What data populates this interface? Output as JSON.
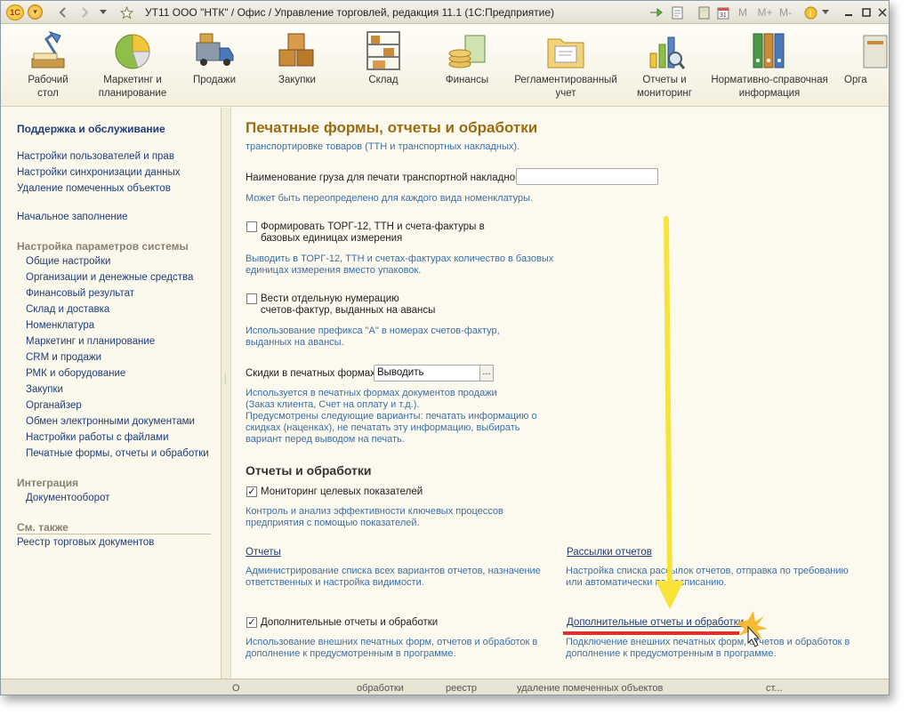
{
  "window": {
    "title": "УТ11 ООО \"НТК\" / Офис / Управление торговлей, редакция 11.1  (1С:Предприятие)",
    "logo": "1С",
    "controls": [
      "minimize",
      "maximize",
      "close"
    ]
  },
  "toolbar_icons": [
    "back-arrow-icon",
    "forward-arrow-icon",
    "dropdown-icon",
    "star-icon"
  ],
  "title_tools": [
    "link-arrow-icon",
    "document-icon",
    "calculator-icon",
    "calendar-icon",
    "M",
    "M+",
    "M-",
    "info-icon"
  ],
  "sections": [
    {
      "label_1": "Рабочий",
      "label_2": "стол",
      "icon": "desk-lamp-icon"
    },
    {
      "label_1": "Маркетинг и",
      "label_2": "планирование",
      "icon": "pie-chart-icon"
    },
    {
      "label_1": "Продажи",
      "label_2": "",
      "icon": "truck-icon"
    },
    {
      "label_1": "Закупки",
      "label_2": "",
      "icon": "boxes-icon"
    },
    {
      "label_1": "Склад",
      "label_2": "",
      "icon": "shelves-icon"
    },
    {
      "label_1": "Финансы",
      "label_2": "",
      "icon": "coins-icon"
    },
    {
      "label_1": "Регламентированный",
      "label_2": "учет",
      "icon": "folder-docs-icon"
    },
    {
      "label_1": "Отчеты и",
      "label_2": "мониторинг",
      "icon": "bar-chart-magnifier-icon"
    },
    {
      "label_1": "Нормативно-справочная",
      "label_2": "информация",
      "icon": "binders-icon"
    },
    {
      "label_1": "Орга",
      "label_2": "",
      "icon": "org-icon"
    }
  ],
  "sidebar": {
    "heading": "Поддержка и обслуживание",
    "items_top": [
      "Настройки пользователей и прав",
      "Настройки синхронизации данных",
      "Удаление помеченных объектов"
    ],
    "initial_fill": "Начальное заполнение",
    "group_system": "Настройка параметров системы",
    "system_items": [
      "Общие настройки",
      "Организации и денежные средства",
      "Финансовый результат",
      "Склад и доставка",
      "Номенклатура",
      "Маркетинг и планирование",
      "CRM и продажи",
      "РМК и оборудование",
      "Закупки",
      "Органайзер",
      "Обмен электронными документами",
      "Настройки работы с файлами",
      "Печатные формы, отчеты и обработки"
    ],
    "group_integration": "Интеграция",
    "integration_items": [
      "Документооборот"
    ],
    "group_see_also": "См. также",
    "see_also_items": [
      "Реестр торговых документов"
    ]
  },
  "content": {
    "page_title": "Печатные формы, отчеты и обработки",
    "intro_note": "транспортировке товаров (ТТН и транспортных накладных).",
    "cargo_label": "Наименование груза для печати транспортной накладной:",
    "cargo_value": "",
    "cargo_note": "Может быть переопределено для каждого вида номенклатуры.",
    "torg12_label_1": "Формировать ТОРГ-12, ТТН и счета-фактуры в",
    "torg12_label_2": "базовых единицах измерения",
    "torg12_checked": false,
    "torg12_note_1": "Выводить в ТОРГ-12, ТТН и счетах-фактурах количество в базовых",
    "torg12_note_2": "единицах измерения вместо упаковок.",
    "numbering_label_1": "Вести отдельную нумерацию",
    "numbering_label_2": "счетов-фактур, выданных на авансы",
    "numbering_checked": false,
    "numbering_note_1": "Использование префикса \"А\" в номерах счетов-фактур,",
    "numbering_note_2": "выданных на авансы.",
    "discounts_label": "Скидки в печатных формах:",
    "discounts_value": "Выводить",
    "discounts_button": "...",
    "discounts_note_1": "Используется в печатных формах документов продажи",
    "discounts_note_2": "(Заказ клиента, Счет на оплату и т.д.).",
    "discounts_note_3": "Предусмотрены следующие варианты: печатать информацию о",
    "discounts_note_4": "скидках (наценках), не печатать эту информацию, выбирать",
    "discounts_note_5": "вариант перед выводом на печать.",
    "section_title": "Отчеты и обработки",
    "monitoring_label": "Мониторинг целевых показателей",
    "monitoring_checked": true,
    "monitoring_note_1": "Контроль и анализ эффективности ключевых процессов",
    "monitoring_note_2": "предприятия с помощью показателей.",
    "reports_link": "Отчеты",
    "reports_note_1": "Администрирование списка всех вариантов отчетов, назначение",
    "reports_note_2": "ответственных и настройка видимости.",
    "mailings_link": "Рассылки отчетов",
    "mailings_note_1": "Настройка списка рассылок отчетов, отправка по требованию",
    "mailings_note_2": "или автоматически по расписанию.",
    "extra_label": "Дополнительные отчеты и обработки",
    "extra_checked": true,
    "extra_note_1": "Использование внешних печатных форм, отчетов и обработок в",
    "extra_note_2": "дополнение к предусмотренным в программе.",
    "extra_link": "Дополнительные отчеты и обработки",
    "extra_link_note_1": "Подключение внешних печатных форм, отчетов и обработок в",
    "extra_link_note_2": "дополнение к предусмотренным в программе."
  },
  "bottom_bar": [
    "О",
    "обработки",
    "реестр",
    "удаление помеченных объектов",
    "ст..."
  ],
  "annotation": {
    "arrow_color": "#f7e43a",
    "underline_color": "#e0322a",
    "burst_color": "#f5b21f"
  }
}
